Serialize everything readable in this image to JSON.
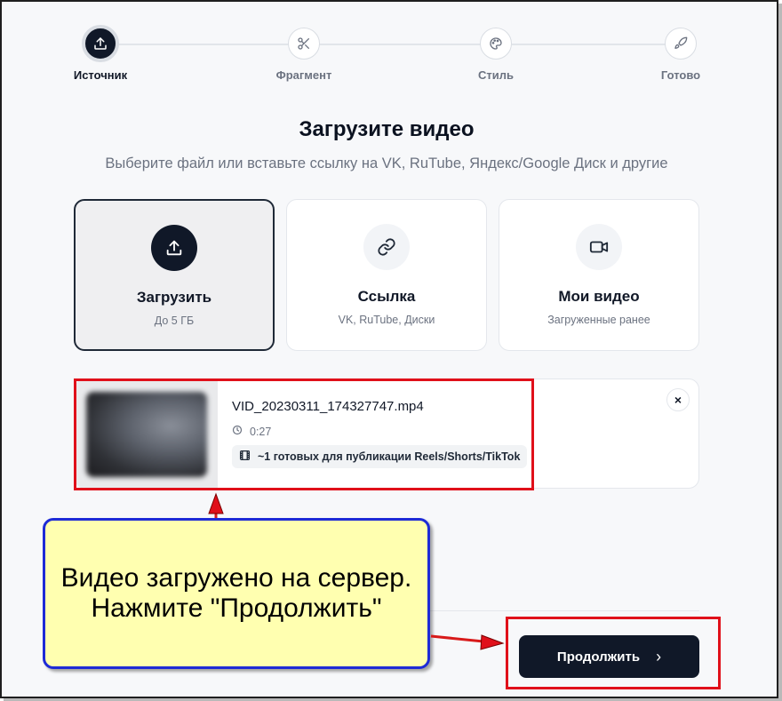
{
  "stepper": {
    "steps": [
      {
        "label": "Источник",
        "icon": "upload-icon",
        "active": true
      },
      {
        "label": "Фрагмент",
        "icon": "scissors-icon",
        "active": false
      },
      {
        "label": "Стиль",
        "icon": "palette-icon",
        "active": false
      },
      {
        "label": "Готово",
        "icon": "rocket-icon",
        "active": false
      }
    ]
  },
  "header": {
    "title": "Загрузите видео",
    "subtitle": "Выберите файл или вставьте ссылку на VK, RuTube, Яндекс/Google Диск и другие"
  },
  "sources": [
    {
      "title": "Загрузить",
      "sub": "До 5 ГБ",
      "icon": "upload-icon",
      "selected": true
    },
    {
      "title": "Ссылка",
      "sub": "VK, RuTube, Диски",
      "icon": "link-icon",
      "selected": false
    },
    {
      "title": "Мои видео",
      "sub": "Загруженные ранее",
      "icon": "video-camera-icon",
      "selected": false
    }
  ],
  "file": {
    "name": "VID_20230311_174327747.mp4",
    "duration": "0:27",
    "ready_text": "~1 готовых для публикации Reels/Shorts/TikTok",
    "close_glyph": "×"
  },
  "actions": {
    "continue_label": "Продолжить",
    "continue_glyph": "›"
  },
  "callout": {
    "line1": "Видео загружено на сервер.",
    "line2": "Нажмите \"Продолжить\""
  },
  "colors": {
    "primary": "#101828",
    "annotation_red": "#e0101a",
    "callout_bg": "#ffffb0",
    "callout_border": "#1e2bd6"
  }
}
